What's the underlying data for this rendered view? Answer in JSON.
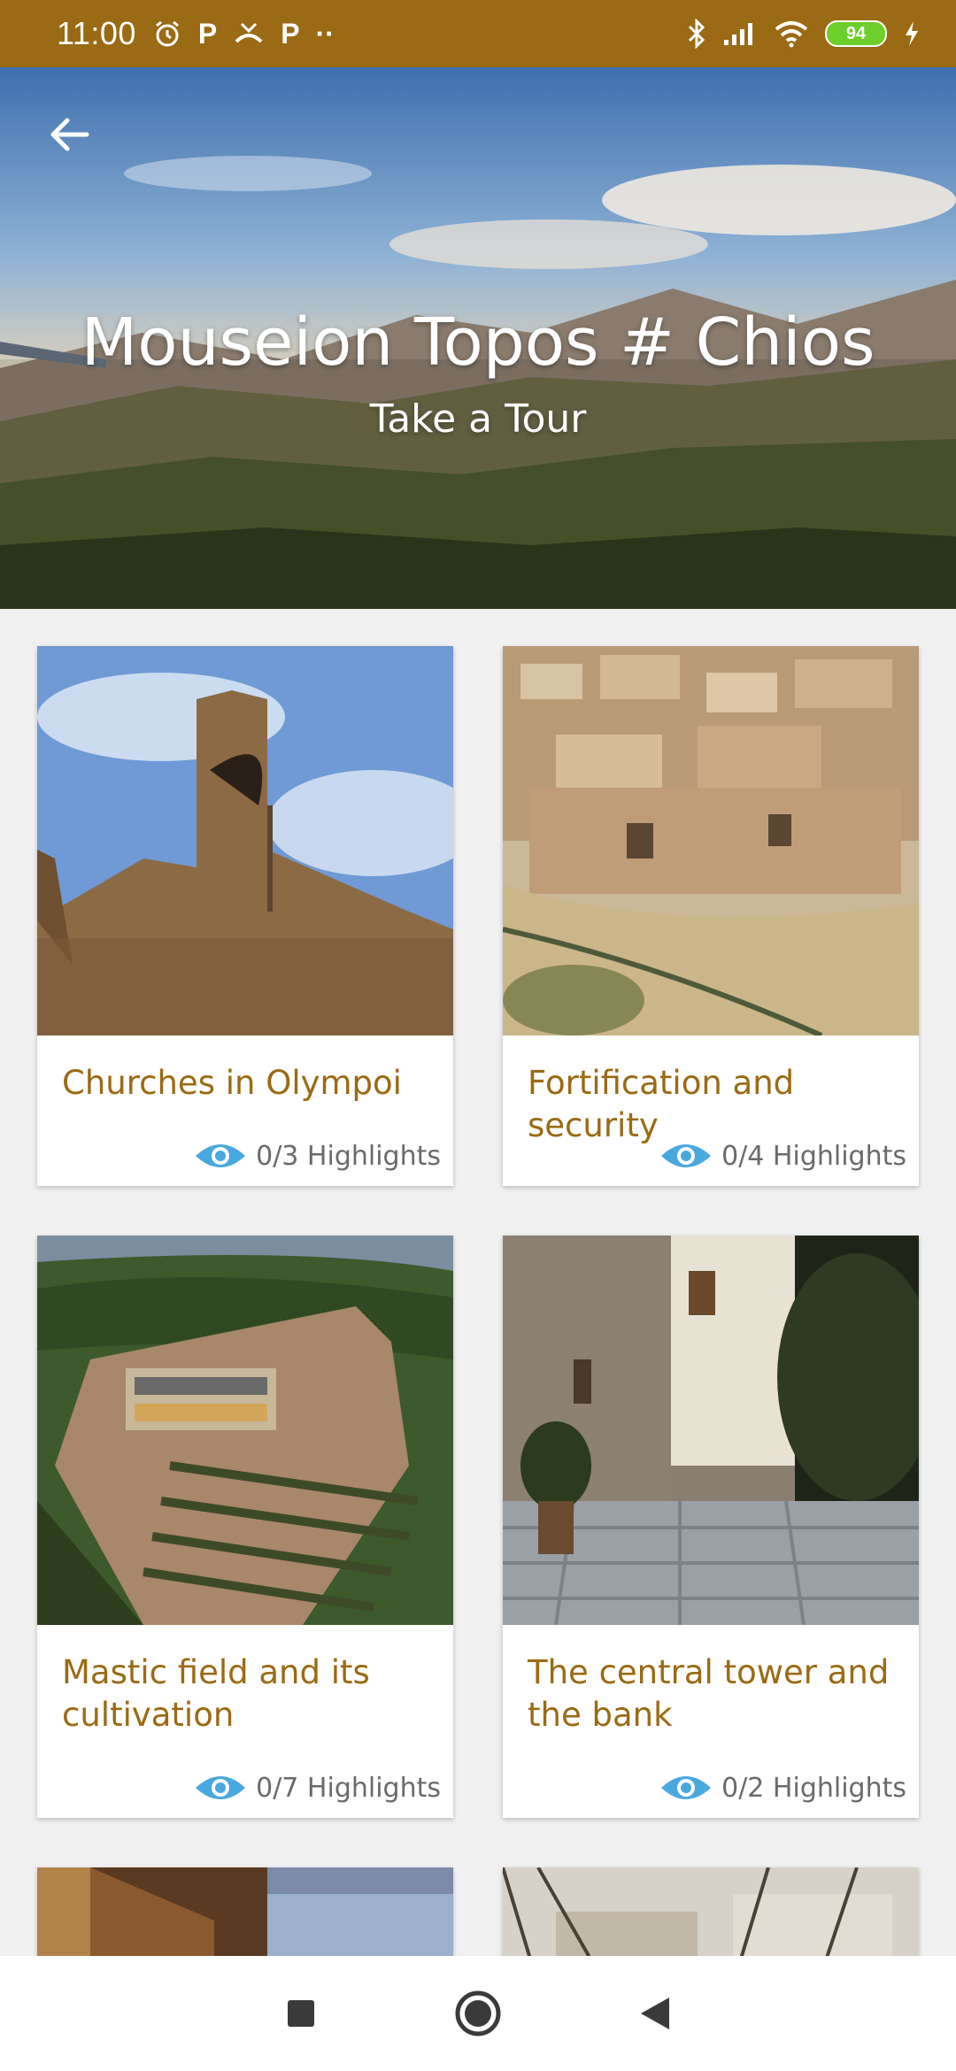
{
  "status_bar": {
    "time": "11:00",
    "icons": [
      "alarm-icon",
      "parking-icon",
      "missed-call-icon",
      "parking-icon",
      "more-dots-icon",
      "bluetooth-icon",
      "signal-icon",
      "wifi-icon",
      "battery-icon",
      "charging-icon"
    ],
    "battery_level": "94"
  },
  "hero": {
    "back_icon": "arrow-left-icon",
    "title": "Mouseion Topos # Chios",
    "subtitle": "Take a Tour"
  },
  "cards": [
    {
      "title": "Churches in Olympoi",
      "highlights": "0/3 Highlights",
      "icon": "eye-icon"
    },
    {
      "title": "Fortification and security",
      "highlights": "0/4 Highlights",
      "icon": "eye-icon"
    },
    {
      "title": "Mastic field and its cultivation",
      "highlights": "0/7 Highlights",
      "icon": "eye-icon"
    },
    {
      "title": "The central tower and the bank",
      "highlights": "0/2 Highlights",
      "icon": "eye-icon"
    }
  ],
  "nav_bar": {
    "icons": [
      "recents-square-icon",
      "home-circle-icon",
      "back-triangle-icon"
    ]
  },
  "colors": {
    "status_bar": "#9a6a14",
    "accent_title": "#9a6a14",
    "eye_icon": "#4aa8e0",
    "background": "#f0f0f0",
    "battery": "#6ccf2a"
  }
}
